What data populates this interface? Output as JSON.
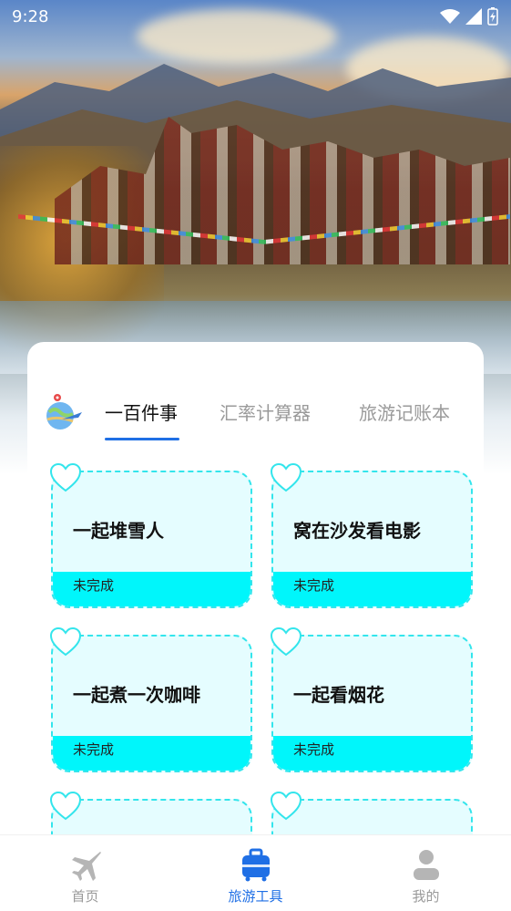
{
  "status_bar": {
    "time": "9:28",
    "icons": [
      "wifi-icon",
      "signal-icon",
      "battery-charging-icon"
    ]
  },
  "tabs": {
    "logo_icon": "travel-globe-plane-icon",
    "items": [
      {
        "label": "一百件事",
        "active": true
      },
      {
        "label": "汇率计算器",
        "active": false
      },
      {
        "label": "旅游记账本",
        "active": false
      }
    ]
  },
  "cards": [
    {
      "title": "一起堆雪人",
      "status": "未完成"
    },
    {
      "title": "窝在沙发看电影",
      "status": "未完成"
    },
    {
      "title": "一起煮一次咖啡",
      "status": "未完成"
    },
    {
      "title": "一起看烟花",
      "status": "未完成"
    },
    {
      "title": "",
      "status": ""
    },
    {
      "title": "",
      "status": ""
    }
  ],
  "bottom_nav": [
    {
      "label": "首页",
      "icon": "airplane-icon",
      "active": false
    },
    {
      "label": "旅游工具",
      "icon": "suitcase-icon",
      "active": true
    },
    {
      "label": "我的",
      "icon": "user-icon",
      "active": false
    }
  ],
  "colors": {
    "accent": "#1f6fe5",
    "card_border": "#33e5ec",
    "card_bg": "#e5fdff",
    "status_bg": "#00f6fb"
  }
}
